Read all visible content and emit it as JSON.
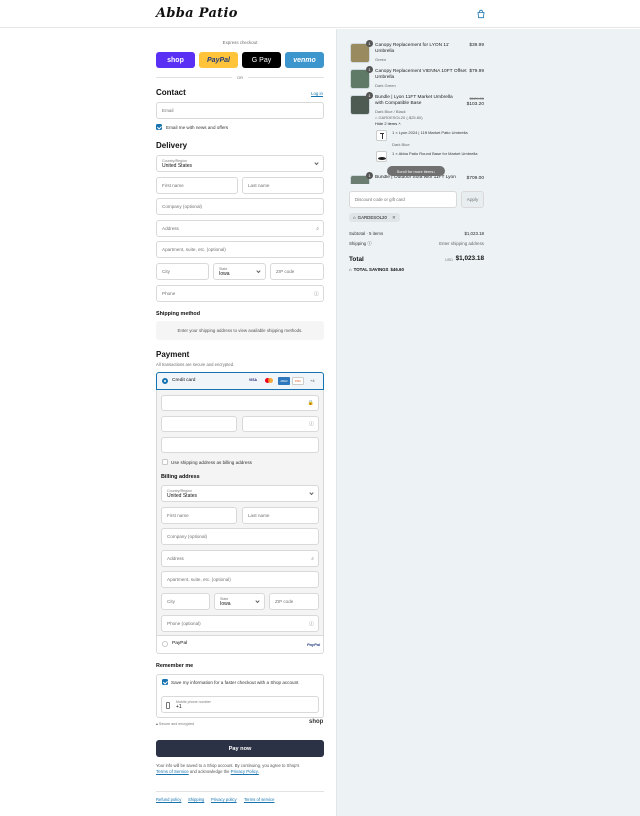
{
  "header": {
    "logo": "Abba Patio"
  },
  "express": {
    "label": "Express checkout",
    "shop": "shop",
    "paypal": "PayPal",
    "gpay": "G Pay",
    "venmo": "venmo",
    "or": "OR"
  },
  "contact": {
    "title": "Contact",
    "login": "Log in",
    "email_placeholder": "Email",
    "news_label": "Email me with news and offers"
  },
  "delivery": {
    "title": "Delivery",
    "country_label": "Country/Region",
    "country_value": "United States",
    "first_name": "First name",
    "last_name": "Last name",
    "company": "Company (optional)",
    "address": "Address",
    "apartment": "Apartment, suite, etc. (optional)",
    "city": "City",
    "state_label": "State",
    "state_value": "Iowa",
    "zip": "ZIP code",
    "phone": "Phone"
  },
  "shipping": {
    "title": "Shipping method",
    "notice": "Enter your shipping address to view available shipping methods."
  },
  "payment": {
    "title": "Payment",
    "subtitle": "All transactions are secure and encrypted.",
    "credit_card": "Credit card",
    "brands": [
      "VISA",
      "MC",
      "AMEX",
      "DISC"
    ],
    "more": "+4",
    "billing_same": "Use shipping address as billing address",
    "paypal": "PayPal",
    "paypal_logo": "PayPal"
  },
  "billing": {
    "title": "Billing address",
    "country_label": "Country/Region",
    "country_value": "United States",
    "first_name": "First name",
    "last_name": "Last name",
    "company": "Company (optional)",
    "address": "Address",
    "apartment": "Apartment, suite, etc. (optional)",
    "city": "City",
    "state_label": "State",
    "state_value": "Iowa",
    "zip": "ZIP code",
    "phone": "Phone (optional)"
  },
  "remember": {
    "title": "Remember me",
    "save_label": "Save my information for a faster checkout with a Shop account",
    "mobile_label": "Mobile phone number",
    "mobile_value": "+1",
    "secure": "Secure and encrypted",
    "shop_logo": "shop"
  },
  "pay_button": "Pay now",
  "legal": {
    "line1": "Your info will be saved to a Shop account. By continuing, you agree to Shop's",
    "terms": "Terms of Service",
    "and": "and acknowledge the",
    "privacy": "Privacy Policy."
  },
  "footer": [
    "Refund policy",
    "Shipping",
    "Privacy policy",
    "Terms of service"
  ],
  "cart": {
    "items": [
      {
        "qty": "1",
        "name": "Canopy Replacement for LYON 11' Umbrella",
        "variant": "Green",
        "price": "$39.99"
      },
      {
        "qty": "1",
        "name": "Canopy Replacement VIENNA 10FT Offset Umbrella",
        "variant": "Dark Green",
        "price": "$79.99"
      },
      {
        "qty": "1",
        "name": "Bundle | Lyon 11FT Market Umbrella with Compatible Base",
        "variant": "Dark Blue / Black",
        "discount": "GARDESOL20 (-$25.80)",
        "hide": "Hide 2 items",
        "old_price": "$129.00",
        "price": "$103.20",
        "sub_items": [
          {
            "name": "1 × Lyon 2024 | 11ft Market Patio Umbrella",
            "variant": "Dark Blue"
          },
          {
            "name": "1 × Abba Patio Round Base for Market Umbrella",
            "variant": ""
          }
        ]
      },
      {
        "qty": "1",
        "name": "Bundle | Outdoor Sofa with 11FT Lyon",
        "variant": "",
        "price": "$709.00"
      }
    ],
    "scroll_hint": "Scroll for more items",
    "discount_placeholder": "Discount code or gift card",
    "apply": "Apply",
    "code_tag": "GARDESOL20",
    "subtotal_label": "Subtotal · 5 items",
    "subtotal_value": "$1,023.18",
    "shipping_label": "Shipping",
    "shipping_value": "Enter shipping address",
    "total_label": "Total",
    "currency": "USD",
    "total_value": "$1,023.18",
    "savings_label": "TOTAL SAVINGS",
    "savings_value": "$46.60"
  },
  "colors": {
    "accent": "#1773b0",
    "pay_button": "#2b3245",
    "shop": "#5a31f4",
    "paypal": "#ffc439",
    "venmo": "#3d95ce",
    "summary_bg": "#edf3f5"
  }
}
